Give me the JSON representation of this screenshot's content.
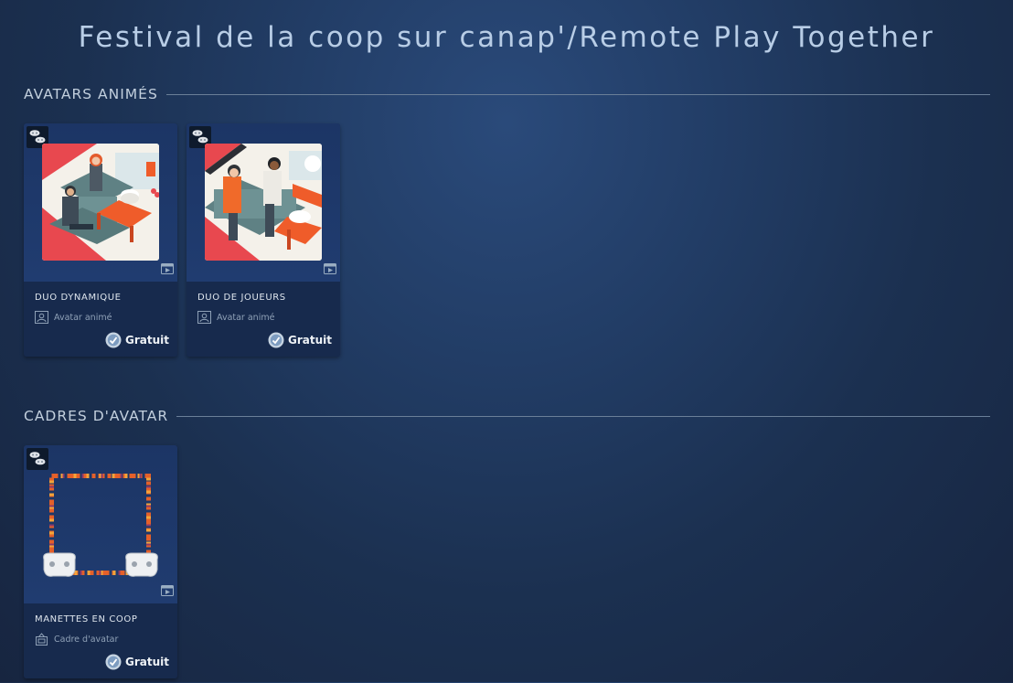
{
  "page": {
    "title": "Festival de la coop sur canap'/Remote Play Together"
  },
  "sections": [
    {
      "title": "AVATARS ANIMÉS",
      "items": [
        {
          "name": "DUO DYNAMIQUE",
          "type": "Avatar animé",
          "price": "Gratuit",
          "type_icon": "avatar-icon",
          "art": "couch-gamers-scene"
        },
        {
          "name": "DUO DE JOUEURS",
          "type": "Avatar animé",
          "price": "Gratuit",
          "type_icon": "avatar-icon",
          "art": "couch-gamers-scene"
        }
      ]
    },
    {
      "title": "CADRES D'AVATAR",
      "items": [
        {
          "name": "MANETTES EN COOP",
          "type": "Cadre d'avatar",
          "price": "Gratuit",
          "type_icon": "frame-icon",
          "art": "controller-frame"
        }
      ]
    }
  ],
  "colors": {
    "accent": "#b8cde6",
    "card_bg": "#172a4d",
    "frame_orange": "#e4602a"
  }
}
